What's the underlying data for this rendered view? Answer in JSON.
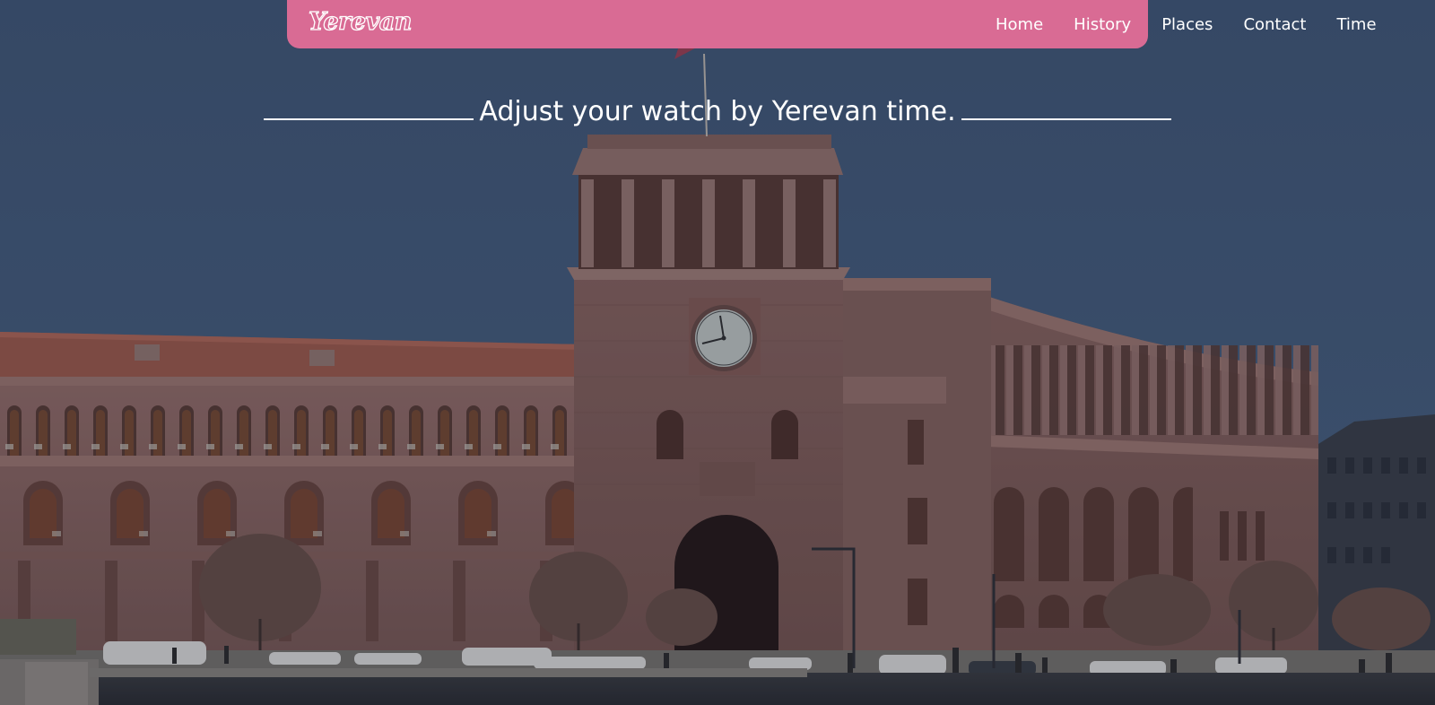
{
  "nav": {
    "brand": "Yerevan",
    "links": [
      "Home",
      "History",
      "Places",
      "Contact",
      "Time"
    ]
  },
  "hero": {
    "headline": "Adjust your watch by Yerevan time.",
    "image": "yerevan-government-house-clock-tower"
  },
  "colors": {
    "navbar": "#d96b94",
    "sky": "#3e5673",
    "stone": "#8f6660",
    "text": "#ffffff"
  }
}
